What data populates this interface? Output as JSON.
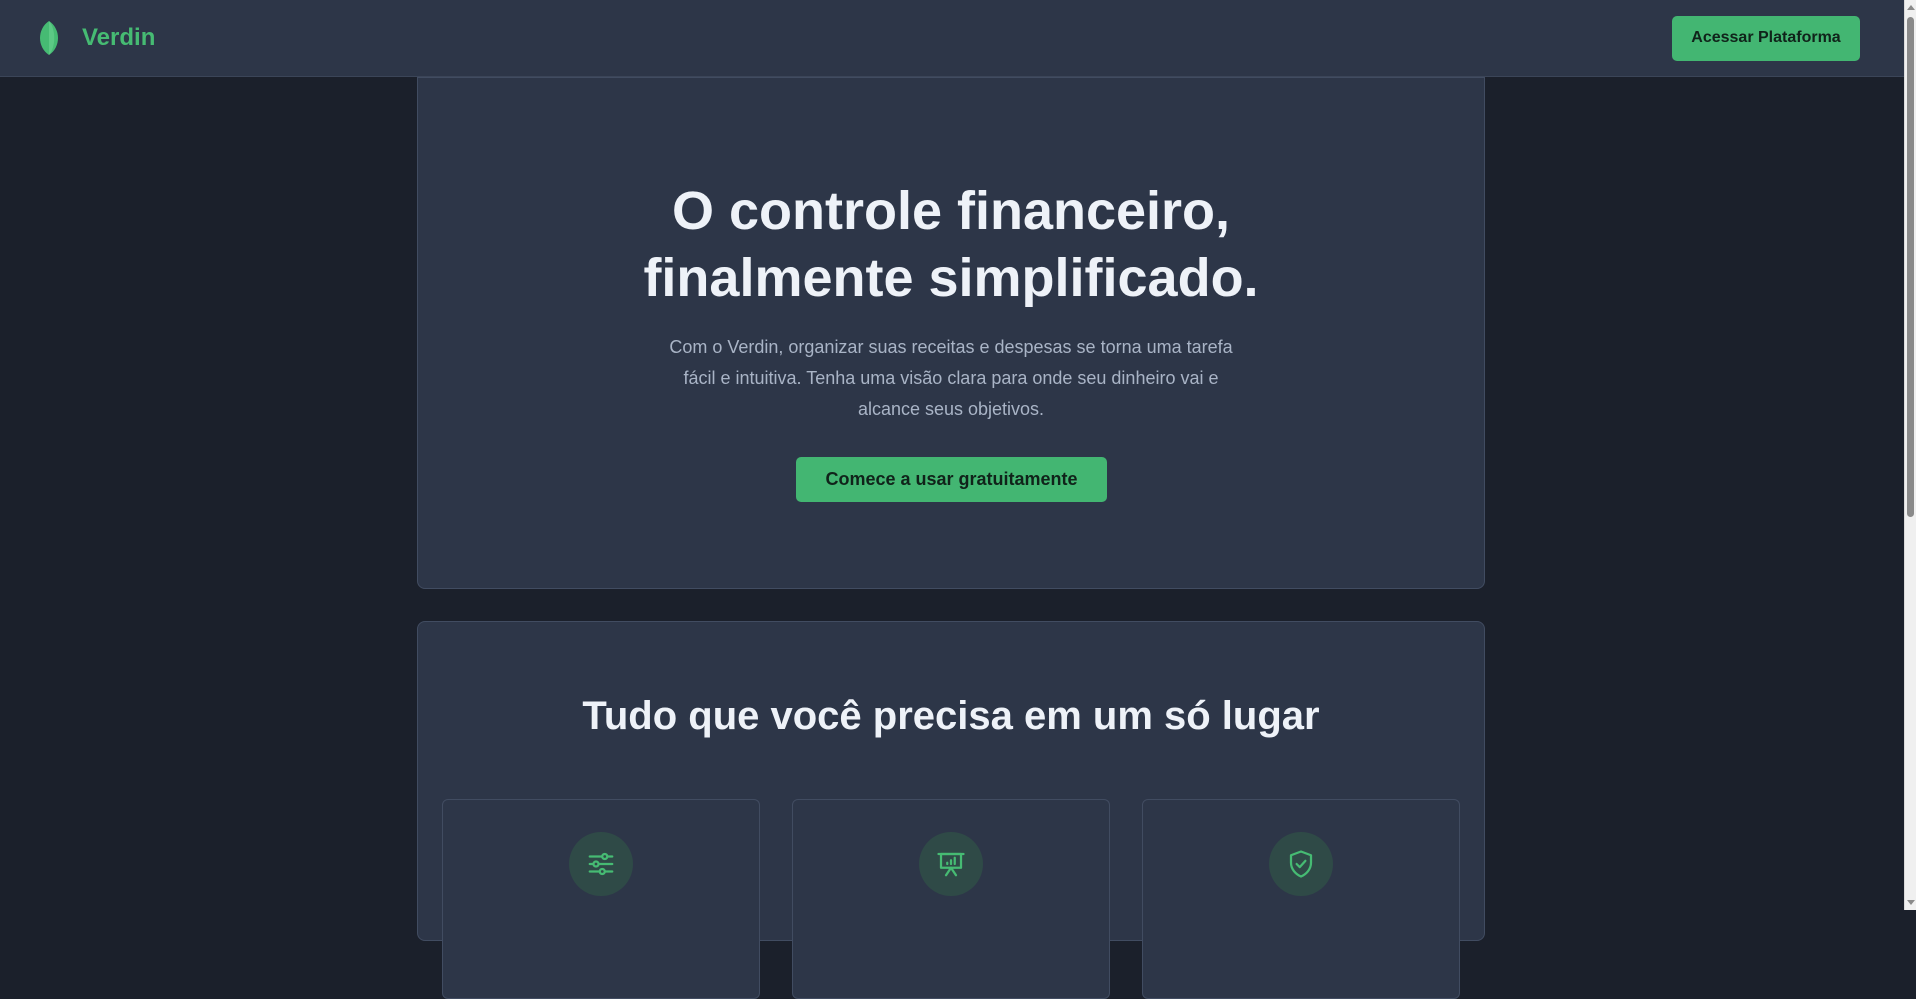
{
  "navbar": {
    "brand_name": "Verdin",
    "cta_label": "Acessar Plataforma",
    "logo_icon": "leaf-icon"
  },
  "hero": {
    "title_line1": "O controle financeiro,",
    "title_line2": "finalmente simplificado.",
    "subtitle": "Com o Verdin, organizar suas receitas e despesas se torna uma tarefa fácil e intuitiva. Tenha uma visão clara para onde seu dinheiro vai e alcance seus objetivos.",
    "cta_label": "Comece a usar gratuitamente"
  },
  "features": {
    "title": "Tudo que você precisa em um só lugar",
    "items": [
      {
        "icon": "sliders-icon"
      },
      {
        "icon": "presentation-chart-icon"
      },
      {
        "icon": "shield-check-icon"
      }
    ]
  },
  "colors": {
    "accent": "#43b672",
    "background": "#1b202b",
    "surface": "#2d3648",
    "text": "#eef2f8",
    "muted": "#a9b4c6"
  }
}
